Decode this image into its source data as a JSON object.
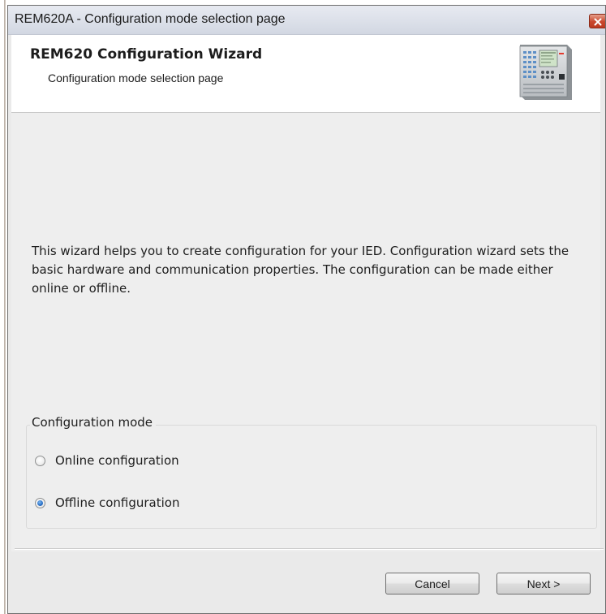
{
  "window": {
    "title": "REM620A - Configuration mode selection page"
  },
  "header": {
    "title": "REM620 Configuration Wizard",
    "subtitle": "Configuration mode selection page",
    "image_icon": "ied-device-image"
  },
  "main": {
    "description": "This wizard helps you to create configuration for your IED. Configuration wizard sets the basic hardware and communication properties. The configuration can be made either online or offline.",
    "configuration_mode": {
      "group_label": "Configuration mode",
      "options": [
        {
          "label": "Online configuration",
          "selected": false
        },
        {
          "label": "Offline configuration",
          "selected": true
        }
      ]
    }
  },
  "footer": {
    "cancel_label": "Cancel",
    "next_label": "Next >"
  },
  "colors": {
    "titlebar": "#dde1ea",
    "close_button": "#c9462c",
    "dialog_background": "#eeeeee",
    "radio_selected": "#2a6fc6"
  }
}
